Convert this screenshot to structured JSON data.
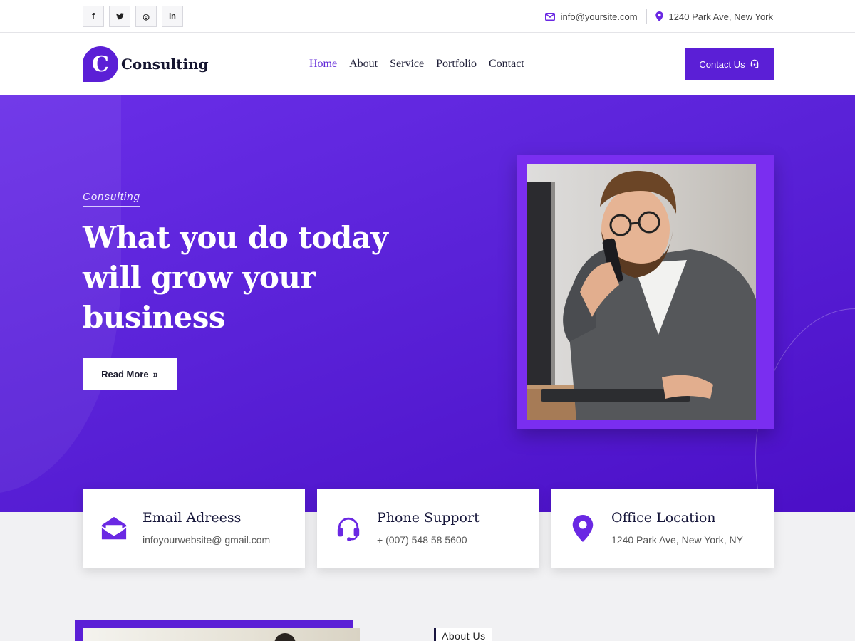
{
  "topbar": {
    "social": [
      {
        "icon": "facebook-icon",
        "glyph": "f"
      },
      {
        "icon": "twitter-icon",
        "glyph": "t"
      },
      {
        "icon": "instagram-icon",
        "glyph": "◎"
      },
      {
        "icon": "linkedin-icon",
        "glyph": "in"
      }
    ],
    "email": "info@yoursite.com",
    "address": "1240 Park Ave, New York"
  },
  "header": {
    "logo_letter": "C",
    "logo_text": "Consulting",
    "nav": [
      "Home",
      "About",
      "Service",
      "Portfolio",
      "Contact"
    ],
    "active_nav": "Home",
    "contact_button": "Contact Us"
  },
  "hero": {
    "kicker": "Consulting",
    "title": "What you do today will grow your business",
    "button": "Read More",
    "button_icon": "»"
  },
  "cards": [
    {
      "icon": "envelope-open-icon",
      "title": "Email Adreess",
      "text": "infoyourwebsite@ gmail.com"
    },
    {
      "icon": "headset-icon",
      "title": "Phone Support",
      "text": "+ (007) 548 58 5600"
    },
    {
      "icon": "location-pin-icon",
      "title": "Office Location",
      "text": "1240 Park Ave, New York, NY"
    }
  ],
  "about": {
    "label": "About Us"
  },
  "colors": {
    "accent": "#5b1fd6",
    "hero_start": "#6a2ee8",
    "hero_end": "#4b0fc7"
  }
}
